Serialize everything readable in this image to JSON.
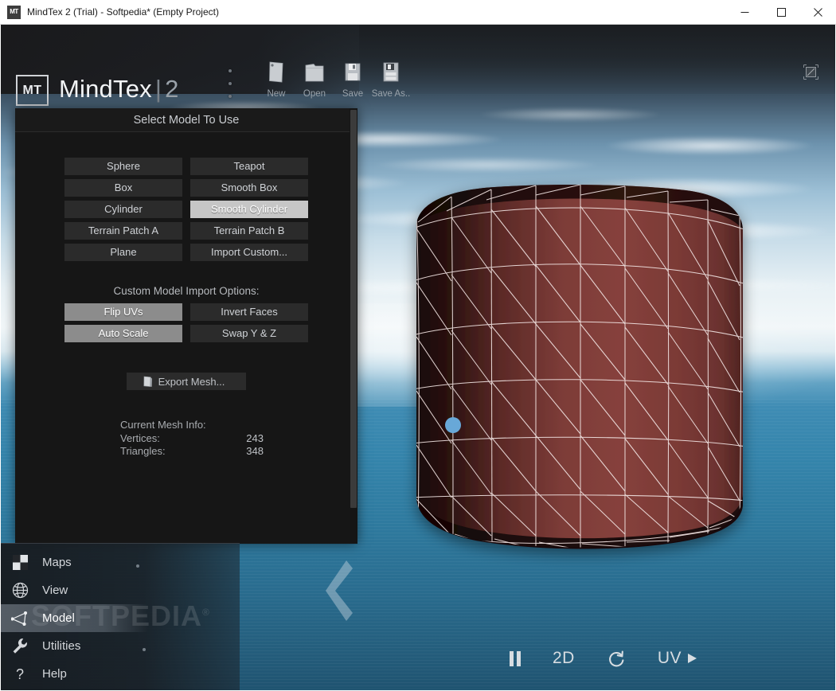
{
  "window": {
    "title": "MindTex 2 (Trial) - Softpedia* (Empty Project)",
    "icon_label": "MT",
    "controls": {
      "minimize": "minimize-icon",
      "maximize": "maximize-icon",
      "close": "close-icon"
    }
  },
  "header": {
    "logo_badge": "MT",
    "logo_name": "MindTex",
    "logo_divider": "|",
    "logo_version": "2",
    "fullscreen_icon": "fullscreen-icon",
    "toolbar": [
      {
        "label": "New",
        "icon": "new-document-icon"
      },
      {
        "label": "Open",
        "icon": "open-folder-icon"
      },
      {
        "label": "Save",
        "icon": "floppy-disk-icon"
      },
      {
        "label": "Save As..",
        "icon": "floppy-disk-plus-icon"
      }
    ]
  },
  "panel": {
    "title": "Select Model To Use",
    "model_buttons": [
      {
        "label": "Sphere",
        "selected": false
      },
      {
        "label": "Teapot",
        "selected": false
      },
      {
        "label": "Box",
        "selected": false
      },
      {
        "label": "Smooth Box",
        "selected": false
      },
      {
        "label": "Cylinder",
        "selected": false
      },
      {
        "label": "Smooth Cylinder",
        "selected": true
      },
      {
        "label": "Terrain Patch A",
        "selected": false
      },
      {
        "label": "Terrain Patch B",
        "selected": false
      },
      {
        "label": "Plane",
        "selected": false
      },
      {
        "label": "Import Custom...",
        "selected": false
      }
    ],
    "import_section_label": "Custom Model Import Options:",
    "import_buttons": [
      {
        "label": "Flip UVs",
        "toggled": true
      },
      {
        "label": "Invert Faces",
        "toggled": false
      },
      {
        "label": "Auto Scale",
        "toggled": true
      },
      {
        "label": "Swap Y & Z",
        "toggled": false
      }
    ],
    "export_button": {
      "label": "Export Mesh...",
      "icon": "export-file-icon"
    },
    "mesh_info": {
      "heading": "Current Mesh Info:",
      "vertices_label": "Vertices:",
      "vertices_value": "243",
      "triangles_label": "Triangles:",
      "triangles_value": "348"
    }
  },
  "nav": {
    "watermark": "SOFTPEDIA",
    "watermark_mark": "®",
    "items": [
      {
        "label": "Maps",
        "icon": "maps-checker-icon",
        "active": false
      },
      {
        "label": "View",
        "icon": "globe-icon",
        "active": false
      },
      {
        "label": "Model",
        "icon": "mesh-triangle-icon",
        "active": true
      },
      {
        "label": "Utilities",
        "icon": "wrench-icon",
        "active": false
      },
      {
        "label": "Help",
        "icon": "question-mark-icon",
        "active": false
      }
    ],
    "collapse_icon": "chevron-left-icon"
  },
  "viewport_toolbar": [
    {
      "label": "",
      "icon": "pause-icon",
      "name": "pause-button"
    },
    {
      "label": "2D",
      "icon": "",
      "name": "2d-view-button"
    },
    {
      "label": "",
      "icon": "reset-rotation-icon",
      "name": "reset-rotation-button"
    },
    {
      "label": "UV",
      "icon": "play-arrow-icon",
      "name": "uv-play-button"
    }
  ],
  "model": {
    "name": "smooth-cylinder-mesh",
    "surface_color": "#7a3b38",
    "wireframe_color": "#f0e3e3",
    "marker_color": "#68a8d8",
    "marker_name": "uv-seam-marker"
  },
  "scene": {
    "sky_top": "#2b3036",
    "sky_horizon": "#f2f7f9",
    "sea_color": "#3585ac"
  }
}
